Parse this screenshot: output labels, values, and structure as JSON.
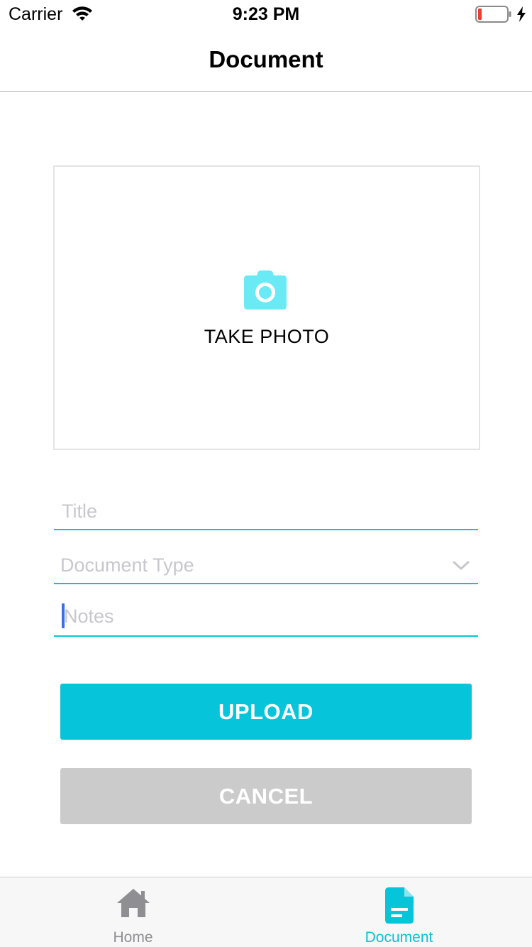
{
  "status_bar": {
    "carrier": "Carrier",
    "time": "9:23 PM",
    "icons": [
      "wifi-icon",
      "battery-low-icon",
      "charging-bolt-icon"
    ],
    "battery_color": "#f23b30"
  },
  "nav": {
    "title": "Document"
  },
  "photo": {
    "label": "TAKE PHOTO",
    "icon": "camera-icon",
    "icon_color": "#69eaf5"
  },
  "form": {
    "title_placeholder": "Title",
    "document_type_placeholder": "Document Type",
    "document_type_icon": "chevron-down-icon",
    "notes_placeholder": "Notes",
    "underline_color": "#06c4d9"
  },
  "buttons": {
    "upload_label": "UPLOAD",
    "cancel_label": "CANCEL",
    "upload_color": "#06c4d9",
    "cancel_color": "#cbcbcb"
  },
  "tab_bar": {
    "tabs": [
      {
        "label": "Home",
        "icon": "home-icon",
        "active": false
      },
      {
        "label": "Document",
        "icon": "document-icon",
        "active": true
      }
    ],
    "active_color": "#06c4d9",
    "inactive_color": "#8e8e93"
  }
}
